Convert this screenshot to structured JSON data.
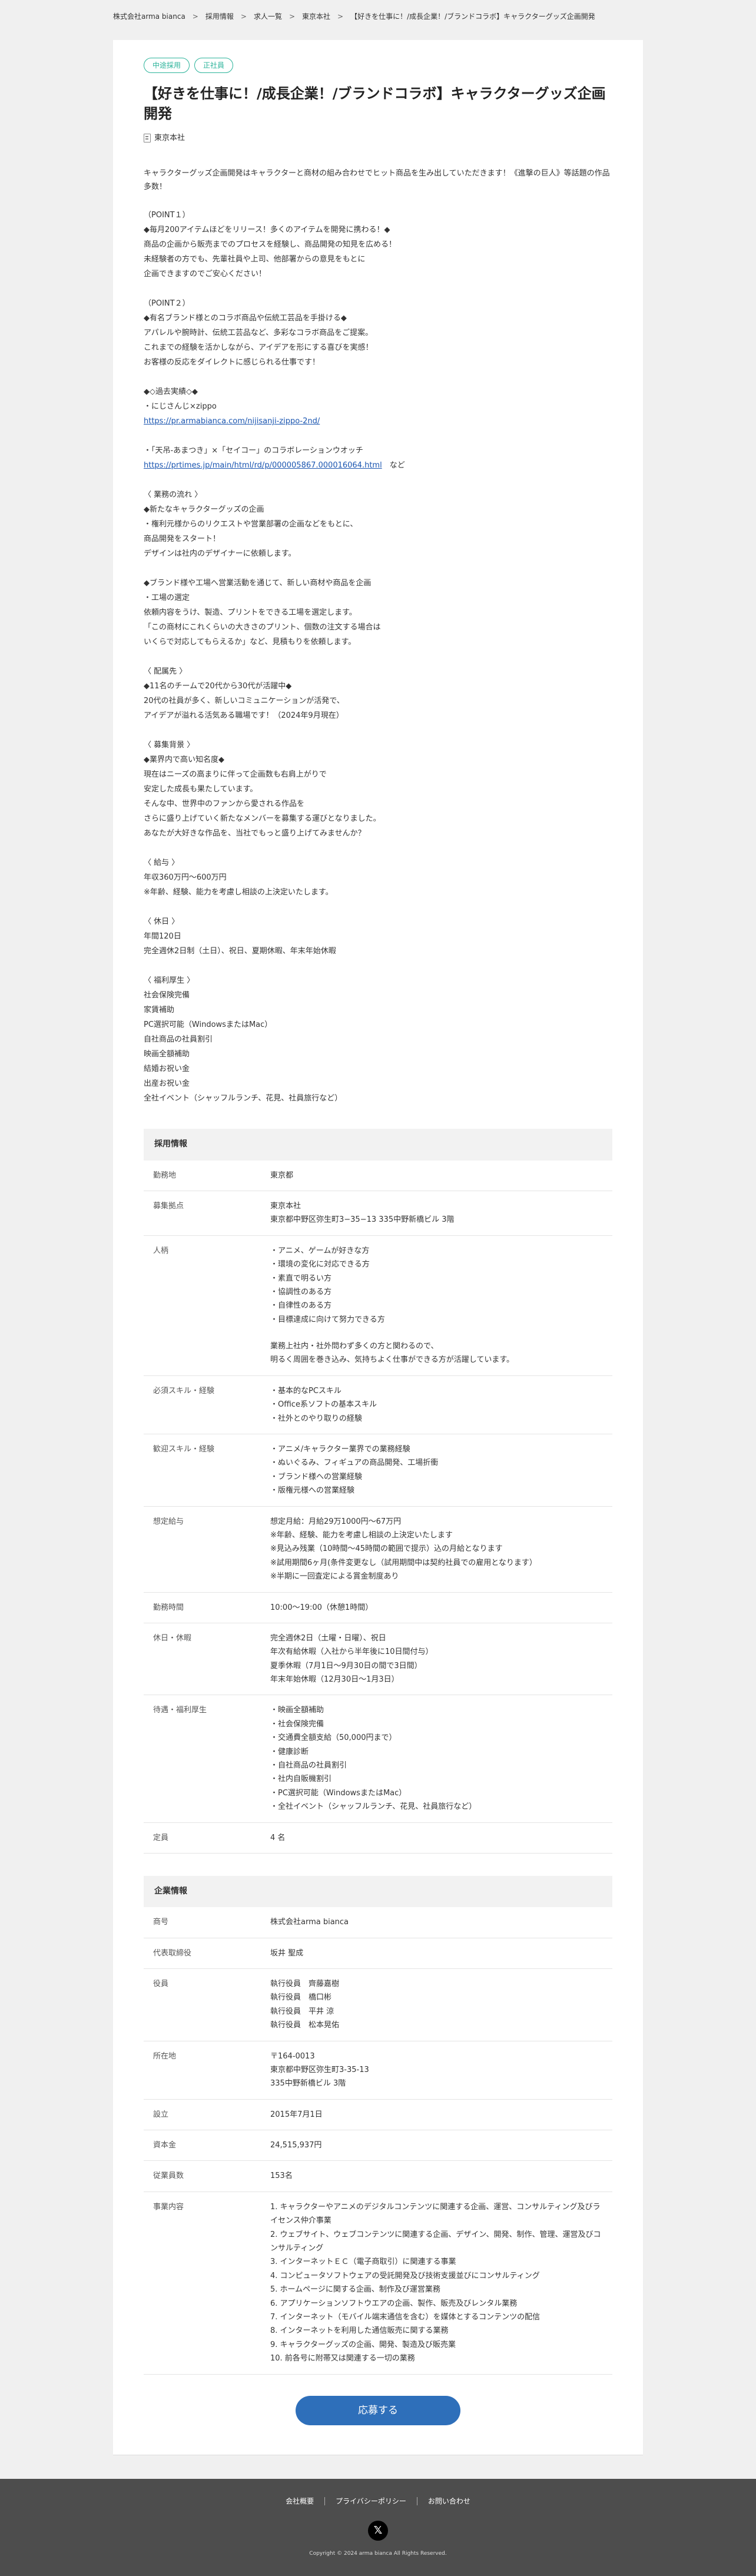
{
  "breadcrumb": [
    "株式会社arma bianca",
    "採用情報",
    "求人一覧",
    "東京本社",
    "【好きを仕事に！/成長企業！/ブランドコラボ】キャラクターグッズ企画開発"
  ],
  "tags": [
    "中途採用",
    "正社員"
  ],
  "job_title": "【好きを仕事に！/成長企業！/ブランドコラボ】キャラクターグッズ企画開発",
  "location": "東京本社",
  "description": [
    "キャラクターグッズ企画開発はキャラクターと商材の組み合わせでヒット商品を生み出していただきます！《進撃の巨人》等話題の作品多数！",
    "",
    "（POINT１）",
    "◆毎月200アイテムほどをリリース！多くのアイテムを開発に携わる！◆",
    "商品の企画から販売までのプロセスを経験し、商品開発の知見を広める！",
    "未経験者の方でも、先輩社員や上司、他部署からの意見をもとに",
    "企画できますのでご安心ください！",
    "",
    "（POINT２）",
    "◆有名ブランド様とのコラボ商品や伝統工芸品を手掛ける◆",
    "アパレルや腕時計、伝統工芸品など、多彩なコラボ商品をご提案。",
    "これまでの経験を活かしながら、アイデアを形にする喜びを実感！",
    "お客様の反応をダイレクトに感じられる仕事です！",
    "",
    "◆◇過去実績◇◆",
    "・にじさんじ×zippo",
    "{link1}",
    "",
    "・「天吊-あまつき」×「セイコー」のコラボレーションウオッチ",
    "{link2}",
    "",
    "〈 業務の流れ 〉",
    "◆新たなキャラクターグッズの企画",
    "・権利元様からのリクエストや営業部署の企画などをもとに、",
    "商品開発をスタート！",
    "デザインは社内のデザイナーに依頼します。",
    "",
    "◆ブランド様や工場へ営業活動を通じて、新しい商材や商品を企画",
    "・工場の選定",
    "依頼内容をうけ、製造、プリントをできる工場を選定します。",
    "「この商材にこれくらいの大きさのプリント、個数の注文する場合は",
    "いくらで対応してもらえるか」など、見積もりを依頼します。",
    "",
    "〈 配属先 〉",
    "◆11名のチームで20代から30代が活躍中◆",
    "20代の社員が多く、新しいコミュニケーションが活発で、",
    "アイデアが溢れる活気ある職場です！（2024年9月現在）",
    "",
    "〈 募集背景 〉",
    "◆業界内で高い知名度◆",
    "現在はニーズの高まりに伴って企画数も右肩上がりで",
    "安定した成長も果たしています。",
    "そんな中、世界中のファンから愛される作品を",
    "さらに盛り上げていく新たなメンバーを募集する運びとなりました。",
    "あなたが大好きな作品を、当社でもっと盛り上げてみませんか？",
    "",
    "〈 給与 〉",
    "年収360万円〜600万円",
    "※年齢、経験、能力を考慮し相談の上決定いたします。",
    "",
    "〈 休日 〉",
    "年間120日",
    "完全週休2日制（土日）、祝日、夏期休暇、年末年始休暇",
    "",
    "〈 福利厚生 〉",
    "社会保険完備",
    "家賃補助",
    "PC選択可能（WindowsまたはMac）",
    "自社商品の社員割引",
    "映画全額補助",
    "結婚お祝い金",
    "出産お祝い金",
    "全社イベント（シャッフルランチ、花見、社員旅行など）"
  ],
  "links": {
    "link1": "https://pr.armabianca.com/nijisanji-zippo-2nd/",
    "link2": "https://prtimes.jp/main/html/rd/p/000005867.000016064.html",
    "link2_suffix": "　など"
  },
  "recruit": {
    "heading": "採用情報",
    "rows": [
      {
        "label": "勤務地",
        "lines": [
          "東京都"
        ]
      },
      {
        "label": "募集拠点",
        "lines": [
          "東京本社",
          "東京都中野区弥生町3−35−13 335中野新橋ビル 3階"
        ]
      },
      {
        "label": "人柄",
        "lines": [
          "・アニメ、ゲームが好きな方",
          "・環境の変化に対応できる方",
          "・素直で明るい方",
          "・協調性のある方",
          "・自律性のある方",
          "・目標達成に向けて努力できる方",
          "",
          "業務上社内・社外問わず多くの方と関わるので、",
          "明るく周囲を巻き込み、気持ちよく仕事ができる方が活躍しています。"
        ]
      },
      {
        "label": "必須スキル・経験",
        "lines": [
          "・基本的なPCスキル",
          "・Office系ソフトの基本スキル",
          "・社外とのやり取りの経験"
        ]
      },
      {
        "label": "歓迎スキル・経験",
        "lines": [
          "・アニメ/キャラクター業界での業務経験",
          "・ぬいぐるみ、フィギュアの商品開発、工場折衝",
          "・ブランド様への営業経験",
          "・版権元様への営業経験"
        ]
      },
      {
        "label": "想定給与",
        "lines": [
          "想定月給：月給29万1000円〜67万円",
          "※年齢、経験、能力を考慮し相談の上決定いたします",
          "※見込み残業（10時間〜45時間の範囲で提示）込の月給となります",
          "※試用期間6ヶ月(条件変更なし（試用期間中は契約社員での雇用となります）",
          "※半期に一回査定による賞金制度あり"
        ]
      },
      {
        "label": "勤務時間",
        "lines": [
          "10:00〜19:00（休憩1時間）"
        ]
      },
      {
        "label": "休日・休暇",
        "lines": [
          "完全週休2日（土曜・日曜）、祝日",
          "年次有給休暇（入社から半年後に10日間付与）",
          "夏季休暇（7月1日〜9月30日の間で3日間）",
          "年末年始休暇（12月30日〜1月3日）"
        ]
      },
      {
        "label": "待遇・福利厚生",
        "lines": [
          "・映画全額補助",
          "・社会保険完備",
          "・交通費全額支給（50,000円まで）",
          "・健康診断",
          "・自社商品の社員割引",
          "・社内自販機割引",
          "・PC選択可能（WindowsまたはMac）",
          "・全社イベント（シャッフルランチ、花見、社員旅行など）"
        ]
      },
      {
        "label": "定員",
        "lines": [
          "4 名"
        ]
      }
    ]
  },
  "company": {
    "heading": "企業情報",
    "rows": [
      {
        "label": "商号",
        "lines": [
          "株式会社arma bianca"
        ]
      },
      {
        "label": "代表取締役",
        "lines": [
          "坂井 聖成"
        ]
      },
      {
        "label": "役員",
        "lines": [
          "執行役員　齊藤嘉樹",
          "執行役員　橋口彬",
          "執行役員　平井 涼",
          "執行役員　松本晃佑"
        ]
      },
      {
        "label": "所在地",
        "lines": [
          "〒164-0013",
          "東京都中野区弥生町3-35-13",
          "335中野新橋ビル 3階"
        ]
      },
      {
        "label": "設立",
        "lines": [
          "2015年7月1日"
        ]
      },
      {
        "label": "資本金",
        "lines": [
          "24,515,937円"
        ]
      },
      {
        "label": "従業員数",
        "lines": [
          "153名"
        ]
      },
      {
        "label": "事業内容",
        "lines": [
          "1. キャラクターやアニメのデジタルコンテンツに関連する企画、運営、コンサルティング及びライセンス仲介事業",
          "2. ウェブサイト、ウェブコンテンツに関連する企画、デザイン、開発、制作、管理、運営及びコンサルティング",
          "3. インターネットＥＣ（電子商取引）に関連する事業",
          "4. コンピュータソフトウェアの受託開発及び技術支援並びにコンサルティング",
          "5. ホームページに関する企画、制作及び運営業務",
          "6. アプリケーションソフトウエアの企画、製作、販売及びレンタル業務",
          "7. インターネット（モバイル端末通信を含む）を媒体とするコンテンツの配信",
          "8. インターネットを利用した通信販売に関する業務",
          "9. キャラクターグッズの企画、開発、製造及び販売業",
          "10. 前各号に附帯又は関連する一切の業務"
        ]
      }
    ]
  },
  "apply_label": "応募する",
  "footer": {
    "links": [
      "会社概要",
      "プライバシーポリシー",
      "お問い合わせ"
    ],
    "social_icon": "x-logo-icon",
    "copyright": "Copyright © 2024 arma bianca All Rights Reserved."
  }
}
